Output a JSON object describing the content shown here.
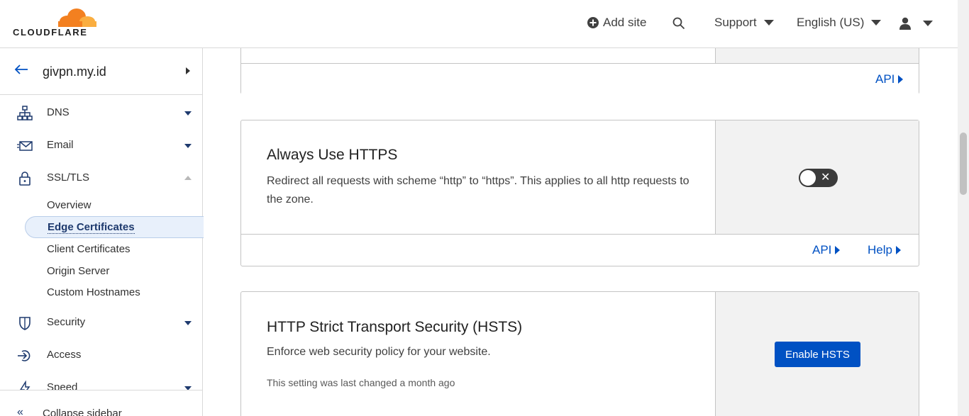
{
  "header": {
    "logo_text": "CLOUDFLARE",
    "add_site": "Add site",
    "support": "Support",
    "language": "English (US)",
    "colors": {
      "logo_orange": "#f38020",
      "logo_light": "#faae40",
      "link_blue": "#0051c3"
    }
  },
  "sidebar": {
    "zone": "givpn.my.id",
    "items": [
      {
        "label": "DNS",
        "icon": "network-icon"
      },
      {
        "label": "Email",
        "icon": "email-icon"
      },
      {
        "label": "SSL/TLS",
        "icon": "lock-icon"
      },
      {
        "label": "Security",
        "icon": "shield-icon"
      },
      {
        "label": "Access",
        "icon": "access-icon"
      },
      {
        "label": "Speed",
        "icon": "bolt-icon"
      }
    ],
    "ssl_sub": [
      "Overview",
      "Edge Certificates",
      "Client Certificates",
      "Origin Server",
      "Custom Hostnames"
    ],
    "collapse": "Collapse sidebar"
  },
  "cards": {
    "top": {
      "api": "API"
    },
    "https": {
      "title": "Always Use HTTPS",
      "desc": "Redirect all requests with scheme “http” to “https”. This applies to all http requests to the zone.",
      "toggle_on": false,
      "api": "API",
      "help": "Help"
    },
    "hsts": {
      "title": "HTTP Strict Transport Security (HSTS)",
      "desc": "Enforce web security policy for your website.",
      "meta": "This setting was last changed a month ago",
      "button": "Enable HSTS"
    }
  }
}
